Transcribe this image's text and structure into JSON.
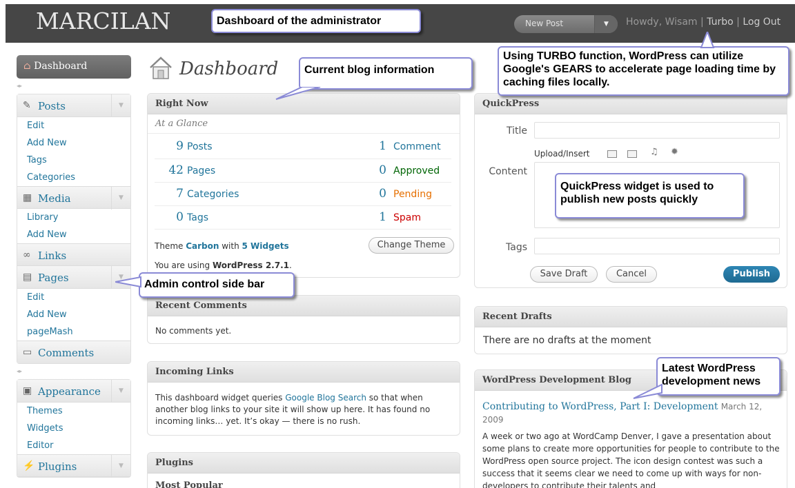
{
  "header": {
    "logo": "MARCILAN",
    "new_post": "New Post",
    "greeting": "Howdy, Wisam",
    "turbo": "Turbo",
    "logout": "Log Out"
  },
  "callouts": {
    "dashboard_admin": "Dashboard of the administrator",
    "current_blog": "Current blog information",
    "turbo": "Using TURBO function, WordPress can utilize Google's GEARS to accelerate page loading time by caching files locally.",
    "quickpress": "QuickPress widget is used to publish new posts quickly",
    "sidebar": "Admin control side bar",
    "dev_news": "Latest WordPress development news"
  },
  "sidebar": {
    "dashboard": "Dashboard",
    "posts": {
      "title": "Posts",
      "items": [
        "Edit",
        "Add New",
        "Tags",
        "Categories"
      ]
    },
    "media": {
      "title": "Media",
      "items": [
        "Library",
        "Add New"
      ]
    },
    "links": {
      "title": "Links"
    },
    "pages": {
      "title": "Pages",
      "items": [
        "Edit",
        "Add New",
        "pageMash"
      ]
    },
    "comments": {
      "title": "Comments"
    },
    "appearance": {
      "title": "Appearance",
      "items": [
        "Themes",
        "Widgets",
        "Editor"
      ]
    },
    "plugins": {
      "title": "Plugins"
    }
  },
  "page_title": "Dashboard",
  "right_now": {
    "title": "Right Now",
    "subtitle": "At a Glance",
    "content": [
      {
        "num": "9",
        "label": "Posts"
      },
      {
        "num": "42",
        "label": "Pages"
      },
      {
        "num": "7",
        "label": "Categories"
      },
      {
        "num": "0",
        "label": "Tags"
      }
    ],
    "discussion": [
      {
        "num": "1",
        "label": "Comment",
        "color": "#21759b"
      },
      {
        "num": "0",
        "label": "Approved",
        "color": "#006505"
      },
      {
        "num": "0",
        "label": "Pending",
        "color": "#e66f00"
      },
      {
        "num": "1",
        "label": "Spam",
        "color": "#cc0000"
      }
    ],
    "theme_prefix": "Theme ",
    "theme_name": "Carbon",
    "theme_with": " with ",
    "widgets": "5 Widgets",
    "change_theme": "Change Theme",
    "version_prefix": "You are using ",
    "version": "WordPress 2.7.1",
    "version_suffix": "."
  },
  "recent_comments": {
    "title": "Recent Comments",
    "text": "No comments yet."
  },
  "incoming_links": {
    "title": "Incoming Links",
    "text_before": "This dashboard widget queries ",
    "link": "Google Blog Search",
    "text_after": " so that when another blog links to your site it will show up here. It has found no incoming links… yet. It’s okay — there is no rush."
  },
  "plugins_box": {
    "title": "Plugins",
    "subtitle": "Most Popular"
  },
  "quickpress": {
    "title": "QuickPress",
    "title_label": "Title",
    "upload_label": "Upload/Insert",
    "content_label": "Content",
    "tags_label": "Tags",
    "save_draft": "Save Draft",
    "cancel": "Cancel",
    "publish": "Publish"
  },
  "recent_drafts": {
    "title": "Recent Drafts",
    "text": "There are no drafts at the moment"
  },
  "dev_blog": {
    "title": "WordPress Development Blog",
    "post_title": "Contributing to WordPress, Part I: Development",
    "post_date": "March 12, 2009",
    "excerpt": "A week or two ago at WordCamp Denver, I gave a presentation about some plans to create more opportunities for people to contribute to the WordPress open source project. The icon design contest was such a success that it seems clear we need to come up with ways for non-developers to contribute their talents and"
  },
  "colors": {
    "link": "#21759b",
    "publish": "#21759b",
    "header": "#464646",
    "callout_border": "#8a8ad6"
  }
}
